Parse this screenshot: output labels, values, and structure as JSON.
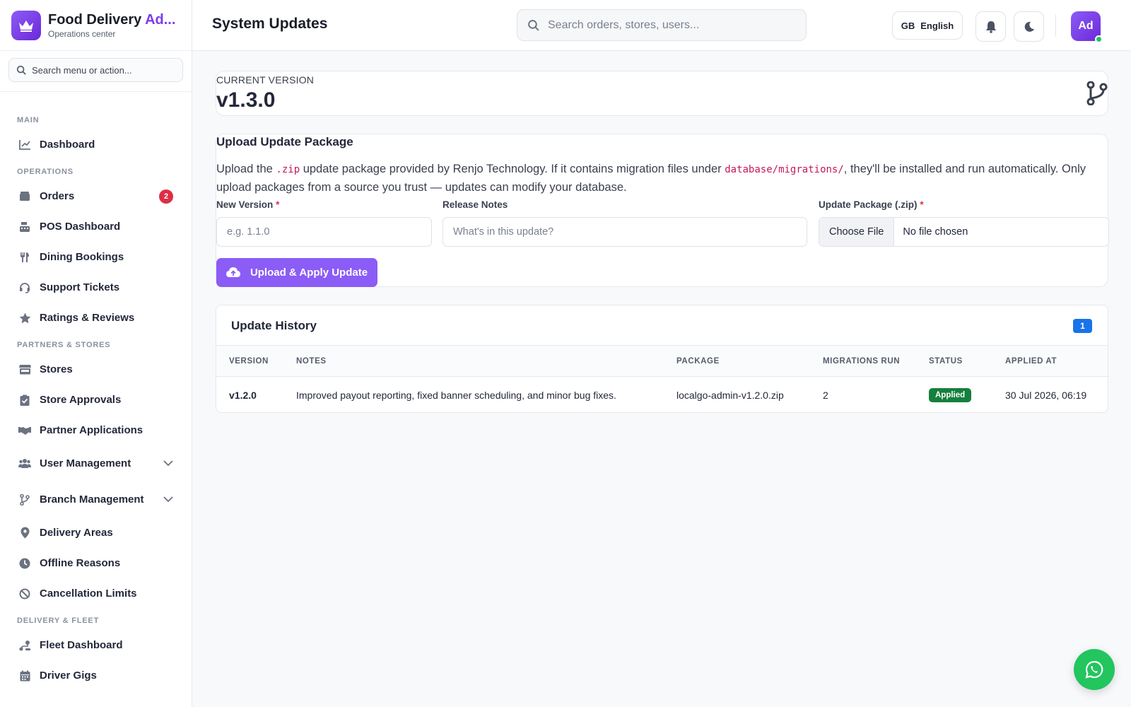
{
  "brand": {
    "title_main": "Food Delivery ",
    "title_accent": "Ad...",
    "subtitle": "Operations center"
  },
  "sidebar": {
    "search_placeholder": "Search menu or action...",
    "sections": {
      "main": "MAIN",
      "operations": "OPERATIONS",
      "partners": "PARTNERS & STORES",
      "delivery": "DELIVERY & FLEET"
    },
    "items": {
      "dashboard": "Dashboard",
      "orders": "Orders",
      "orders_badge": "2",
      "pos": "POS Dashboard",
      "dining": "Dining Bookings",
      "support": "Support Tickets",
      "ratings": "Ratings & Reviews",
      "stores": "Stores",
      "store_approvals": "Store Approvals",
      "partner_apps": "Partner Applications",
      "user_mgmt": "User Management",
      "branch_mgmt": "Branch Management",
      "delivery_areas": "Delivery Areas",
      "offline_reasons": "Offline Reasons",
      "cancellation": "Cancellation Limits",
      "fleet": "Fleet Dashboard",
      "driver_gigs": "Driver Gigs"
    }
  },
  "header": {
    "title": "System Updates",
    "search_placeholder": "Search orders, stores, users...",
    "lang_flag": "GB",
    "lang_label": "English",
    "avatar": "Ad"
  },
  "version": {
    "label": "CURRENT VERSION",
    "value": "v1.3.0"
  },
  "upload": {
    "title": "Upload Update Package",
    "desc_1": "Upload the ",
    "desc_code1": ".zip",
    "desc_2": " update package provided by Renjo Technology. If it contains migration files under ",
    "desc_code2": "database/migrations/",
    "desc_3": ", they'll be installed and run automatically. Only upload packages from a source you trust — updates can modify your database.",
    "version_label": "New Version",
    "version_placeholder": "e.g. 1.1.0",
    "notes_label": "Release Notes",
    "notes_placeholder": "What's in this update?",
    "package_label": "Update Package (.zip)",
    "file_button": "Choose File",
    "file_status": "No file chosen",
    "required_mark": "*",
    "submit": "Upload & Apply Update"
  },
  "history": {
    "title": "Update History",
    "count": "1",
    "columns": [
      "VERSION",
      "NOTES",
      "PACKAGE",
      "MIGRATIONS RUN",
      "STATUS",
      "APPLIED AT"
    ],
    "rows": [
      {
        "version": "v1.2.0",
        "notes": "Improved payout reporting, fixed banner scheduling, and minor bug fixes.",
        "package": "localgo-admin-v1.2.0.zip",
        "migrations": "2",
        "status": "Applied",
        "applied_at": "30 Jul 2026, 06:19"
      }
    ]
  },
  "colors": {
    "accent": "#8b5cf6",
    "badge_red": "#dc2f45",
    "status_green": "#15803d",
    "count_blue": "#1a73e8",
    "whatsapp": "#22c55e"
  }
}
